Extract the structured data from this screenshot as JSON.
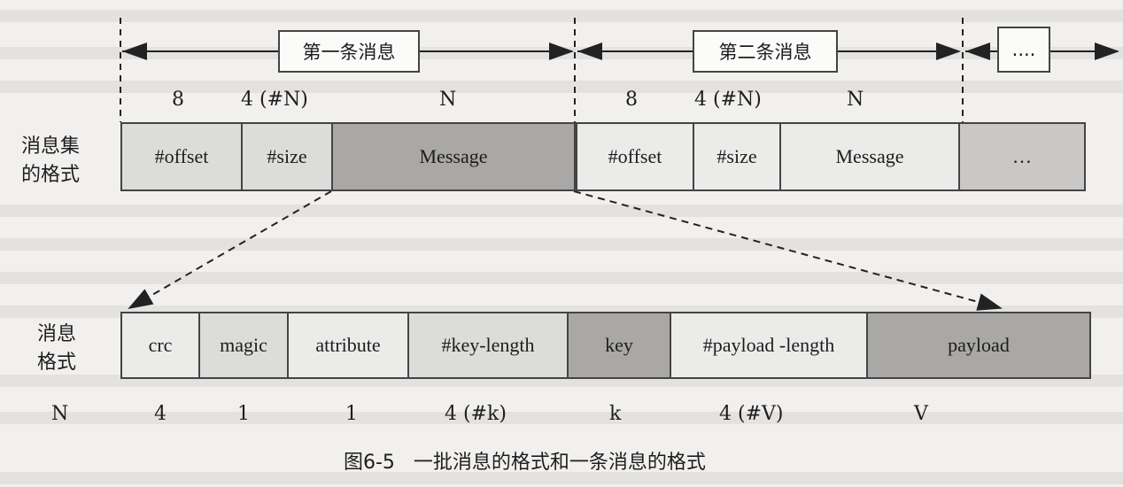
{
  "top_messages": {
    "first": "第一条消息",
    "second": "第二条消息",
    "more": "...."
  },
  "set_sizes": [
    "8",
    "4 (#N)",
    "N",
    "8",
    "4 (#N)",
    "N"
  ],
  "set_label": "消息集的格式",
  "set_label_lines": [
    "消息集",
    "的格式"
  ],
  "set_cells": [
    "#offset",
    "#size",
    "Message",
    "#offset",
    "#size",
    "Message",
    "…"
  ],
  "msg_label": "消息格式",
  "msg_label_lines": [
    "消息",
    "格式"
  ],
  "msg_cells": [
    "crc",
    "magic",
    "attribute",
    "#key-length",
    "key",
    "#payload -length",
    "payload"
  ],
  "msg_sizes": [
    "N",
    "4",
    "1",
    "1",
    "4 (#k)",
    "k",
    "4 (#V)",
    "V"
  ],
  "caption": "图6-5   一批消息的格式和一条消息的格式",
  "colors": {
    "background": "#f1f0ee",
    "cell_light": "#dcdcda",
    "cell_mid": "#c9c8c6",
    "cell_dark": "#a9a8a6",
    "line": "#222222"
  }
}
